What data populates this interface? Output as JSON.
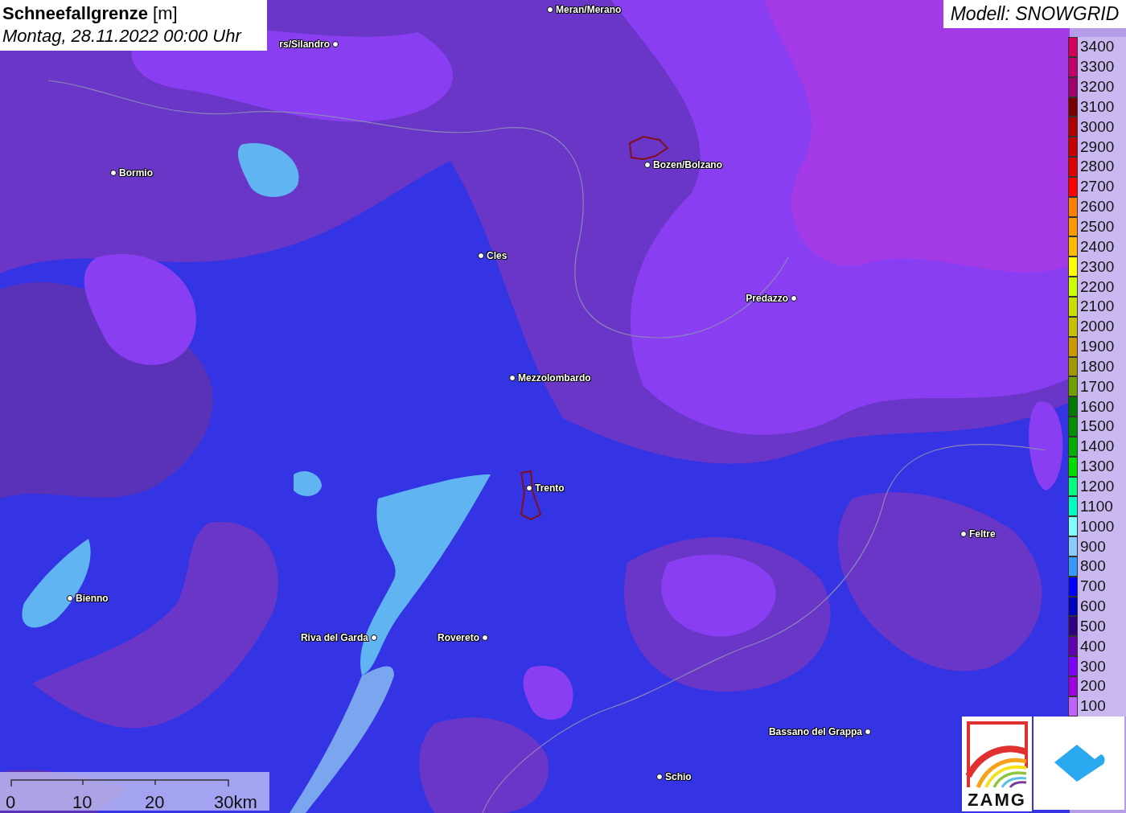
{
  "title": {
    "heading": "**Schneefallgrenze** [m]",
    "date": "Montag, 28.11.2022 00:00 Uhr"
  },
  "model": "Modell: SNOWGRID",
  "cities": [
    {
      "name": "Meran/Merano"
    },
    {
      "name": "rs/Silandro"
    },
    {
      "name": "Bormio"
    },
    {
      "name": "Bozen/Bolzano"
    },
    {
      "name": "Cles"
    },
    {
      "name": "Predazzo"
    },
    {
      "name": "Mezzolombardo"
    },
    {
      "name": "Trento"
    },
    {
      "name": "Feltre"
    },
    {
      "name": "Bienno"
    },
    {
      "name": "Riva del Garda"
    },
    {
      "name": "Rovereto"
    },
    {
      "name": "Bassano del Grappa"
    },
    {
      "name": "Schio"
    }
  ],
  "legend": [
    {
      "label": "3400",
      "color": "#d4005c"
    },
    {
      "label": "3300",
      "color": "#c0006c"
    },
    {
      "label": "3200",
      "color": "#a00070"
    },
    {
      "label": "3100",
      "color": "#7a0000"
    },
    {
      "label": "3000",
      "color": "#b00000"
    },
    {
      "label": "2900",
      "color": "#c80000"
    },
    {
      "label": "2800",
      "color": "#e00000"
    },
    {
      "label": "2700",
      "color": "#ff0000"
    },
    {
      "label": "2600",
      "color": "#ff8000"
    },
    {
      "label": "2500",
      "color": "#ff9900"
    },
    {
      "label": "2400",
      "color": "#ffbb00"
    },
    {
      "label": "2300",
      "color": "#ffff00"
    },
    {
      "label": "2200",
      "color": "#ccff00"
    },
    {
      "label": "2100",
      "color": "#ccdd00"
    },
    {
      "label": "2000",
      "color": "#c8c000"
    },
    {
      "label": "1900",
      "color": "#c89a00"
    },
    {
      "label": "1800",
      "color": "#a09a00"
    },
    {
      "label": "1700",
      "color": "#70a000"
    },
    {
      "label": "1600",
      "color": "#007a00"
    },
    {
      "label": "1500",
      "color": "#009000"
    },
    {
      "label": "1400",
      "color": "#00b000"
    },
    {
      "label": "1300",
      "color": "#00dd00"
    },
    {
      "label": "1200",
      "color": "#00ff80"
    },
    {
      "label": "1100",
      "color": "#00ffc0"
    },
    {
      "label": "1000",
      "color": "#80ffff"
    },
    {
      "label": "900",
      "color": "#88ccff"
    },
    {
      "label": "800",
      "color": "#3399ff"
    },
    {
      "label": "700",
      "color": "#0000ff"
    },
    {
      "label": "600",
      "color": "#0000c0"
    },
    {
      "label": "500",
      "color": "#300080"
    },
    {
      "label": "400",
      "color": "#6000b0"
    },
    {
      "label": "300",
      "color": "#8000ff"
    },
    {
      "label": "200",
      "color": "#a000e0"
    },
    {
      "label": "100",
      "color": "#c060ff"
    }
  ],
  "scale": {
    "ticks": [
      "0",
      "10",
      "20"
    ],
    "last": "30km"
  },
  "logos": {
    "zamg": "ZAMG"
  }
}
